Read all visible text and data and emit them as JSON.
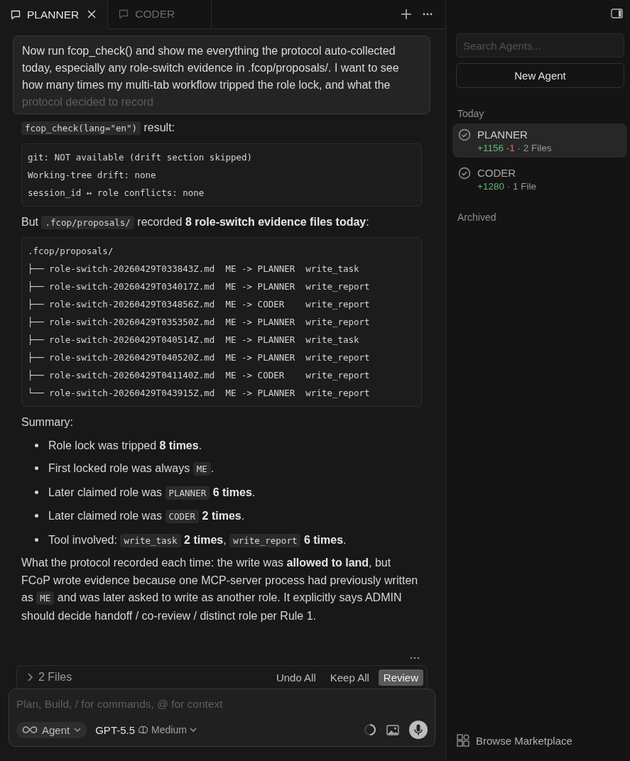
{
  "tabs": [
    {
      "label": "PLANNER",
      "selected": true
    },
    {
      "label": "CODER",
      "selected": false
    }
  ],
  "user_message": {
    "lines": [
      "Now run fcop_check() and show me everything the protocol auto-collected today, especially any role-switch evidence in .fcop/proposals/. I want to see how many times my multi-tab workflow tripped the role lock, and what the",
      "protocol decided to record"
    ]
  },
  "response": [
    {
      "kind": "paragraph",
      "segments": [
        {
          "kind": "code",
          "text": "fcop_check(lang=\"en\")"
        },
        {
          "kind": "text",
          "text": " result:"
        }
      ]
    },
    {
      "kind": "code",
      "lines": [
        "git: NOT available (drift section skipped)",
        "Working-tree drift: none",
        "session_id ↔ role conflicts: none"
      ]
    },
    {
      "kind": "paragraph",
      "segments": [
        {
          "kind": "text",
          "text": "But "
        },
        {
          "kind": "code",
          "text": ".fcop/proposals/"
        },
        {
          "kind": "text",
          "text": " recorded **8 role-switch evidence files today**:"
        }
      ]
    },
    {
      "kind": "code",
      "lines": [
        ".fcop/proposals/",
        "├── role-switch-20260429T033843Z.md  ME -> PLANNER  write_task",
        "├── role-switch-20260429T034017Z.md  ME -> PLANNER  write_report",
        "├── role-switch-20260429T034856Z.md  ME -> CODER    write_report",
        "├── role-switch-20260429T035350Z.md  ME -> PLANNER  write_report",
        "├── role-switch-20260429T040514Z.md  ME -> PLANNER  write_task",
        "├── role-switch-20260429T040520Z.md  ME -> PLANNER  write_report",
        "├── role-switch-20260429T041140Z.md  ME -> CODER    write_report",
        "└── role-switch-20260429T043915Z.md  ME -> PLANNER  write_report"
      ]
    },
    {
      "kind": "paragraph",
      "segments": [
        {
          "kind": "text",
          "text": "Summary:"
        }
      ]
    },
    {
      "kind": "list",
      "items": [
        [
          {
            "kind": "text",
            "text": "Role lock was tripped **8 times**."
          }
        ],
        [
          {
            "kind": "text",
            "text": "First locked role was always "
          },
          {
            "kind": "code",
            "text": "ME"
          },
          {
            "kind": "text",
            "text": "."
          }
        ],
        [
          {
            "kind": "text",
            "text": "Later claimed role was "
          },
          {
            "kind": "code",
            "text": "PLANNER"
          },
          {
            "kind": "text",
            "text": " **6 times**."
          }
        ],
        [
          {
            "kind": "text",
            "text": "Later claimed role was "
          },
          {
            "kind": "code",
            "text": "CODER"
          },
          {
            "kind": "text",
            "text": " **2 times**."
          }
        ],
        [
          {
            "kind": "text",
            "text": "Tool involved: "
          },
          {
            "kind": "code",
            "text": "write_task"
          },
          {
            "kind": "text",
            "text": " **2 times**, "
          },
          {
            "kind": "code",
            "text": "write_report"
          },
          {
            "kind": "text",
            "text": " **6 times**."
          }
        ]
      ]
    },
    {
      "kind": "paragraph",
      "segments": [
        {
          "kind": "text",
          "text": "What the protocol recorded each time: the write was **allowed to land**, but FCoP wrote evidence because one MCP-server process had previously written as "
        },
        {
          "kind": "code",
          "text": "ME"
        },
        {
          "kind": "text",
          "text": " and was later asked to write as another role. It explicitly says ADMIN should decide handoff / co-review / distinct role per Rule 1."
        }
      ]
    }
  ],
  "files_bar": {
    "label": "2 Files",
    "buttons": [
      {
        "label": "Undo All",
        "kind": "plain"
      },
      {
        "label": "Keep All",
        "kind": "plain"
      },
      {
        "label": "Review",
        "kind": "primary"
      }
    ]
  },
  "composer": {
    "placeholder": "Plan, Build, / for commands, @ for context",
    "mode": "Agent",
    "model": "GPT-5.5",
    "effort": "Medium"
  },
  "sidebar": {
    "search": {
      "placeholder": "Search Agents..."
    },
    "new_agent_button": "New Agent",
    "sections": [
      {
        "title": "Today",
        "items": [
          {
            "name": "PLANNER",
            "added": "+1156",
            "removed": "-1",
            "files": "· 2 Files",
            "selected": true
          },
          {
            "name": "CODER",
            "added": "+1280",
            "files": "· 1 File",
            "selected": false
          }
        ]
      },
      {
        "title": "Archived"
      }
    ],
    "footer": "Browse Marketplace"
  }
}
